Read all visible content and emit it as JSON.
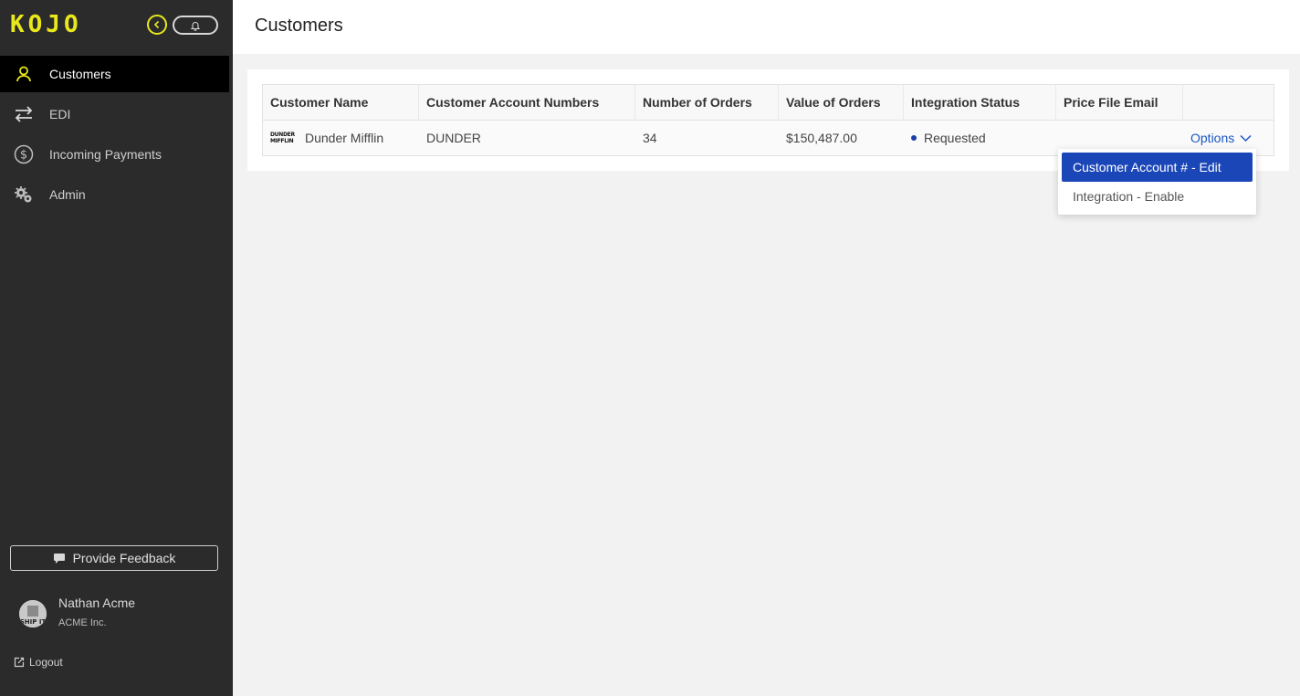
{
  "brand": {
    "logo_text": "KOJO",
    "accent_color": "#e8e81c"
  },
  "sidebar": {
    "items": [
      {
        "label": "Customers",
        "icon": "person-icon",
        "active": true
      },
      {
        "label": "EDI",
        "icon": "swap-arrows-icon",
        "active": false
      },
      {
        "label": "Incoming Payments",
        "icon": "dollar-circle-icon",
        "active": false
      },
      {
        "label": "Admin",
        "icon": "gears-icon",
        "active": false
      }
    ],
    "feedback_label": "Provide Feedback",
    "user": {
      "name": "Nathan Acme",
      "org": "ACME Inc.",
      "avatar_text": "SHIP IT"
    },
    "logout_label": "Logout"
  },
  "header": {
    "title": "Customers"
  },
  "table": {
    "columns": [
      "Customer Name",
      "Customer Account Numbers",
      "Number of Orders",
      "Value of Orders",
      "Integration Status",
      "Price File Email",
      ""
    ],
    "rows": [
      {
        "logo_line1": "DUNDER",
        "logo_line2": "MIFFLIN",
        "name": "Dunder Mifflin",
        "account": "DUNDER",
        "orders": "34",
        "value": "$150,487.00",
        "status": "Requested",
        "status_color": "#1a3fa8",
        "price_email": "",
        "options_label": "Options"
      }
    ]
  },
  "dropdown": {
    "items": [
      {
        "label": "Customer Account # - Edit",
        "selected": true
      },
      {
        "label": "Integration - Enable",
        "selected": false
      }
    ]
  }
}
